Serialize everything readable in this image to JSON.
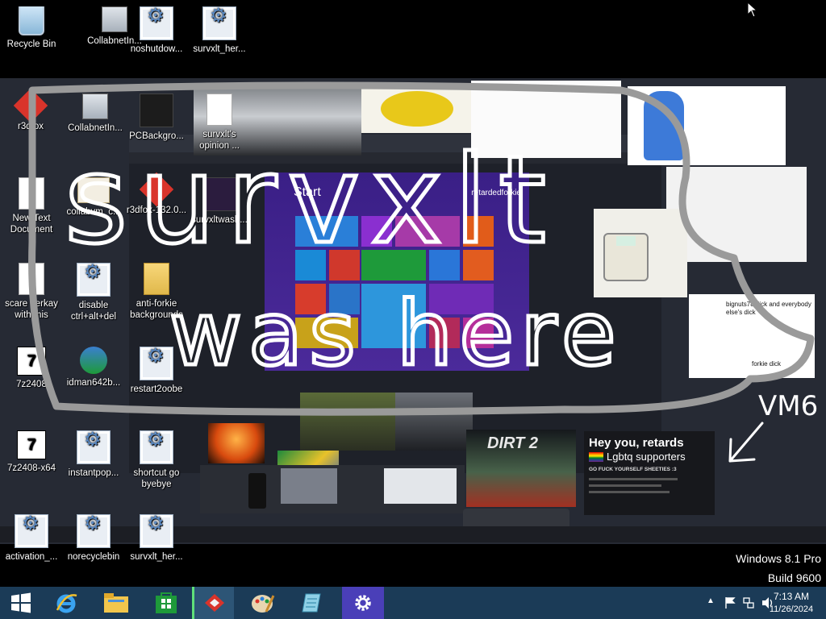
{
  "desktop": {
    "icons": [
      {
        "label": "Recycle Bin"
      },
      {
        "label": "CollabnetIn..."
      },
      {
        "label": "noshutdow..."
      },
      {
        "label": "survxlt_her..."
      },
      {
        "label": "r3dfox"
      },
      {
        "label": "CollabnetIn..."
      },
      {
        "label": "PCBackgro..."
      },
      {
        "label": "survxlt's opinion ..."
      },
      {
        "label": "New Text Document"
      },
      {
        "label": "collabvm_c..."
      },
      {
        "label": "r3dfox-132.0..."
      },
      {
        "label": "survxltwash..."
      },
      {
        "label": "scare berkay with this"
      },
      {
        "label": "disable ctrl+alt+del"
      },
      {
        "label": "anti-forkie backgrounds"
      },
      {
        "label": "7z2408"
      },
      {
        "label": "idman642b..."
      },
      {
        "label": "restart2oobe"
      },
      {
        "label": "7z2408-x64"
      },
      {
        "label": "instantpop..."
      },
      {
        "label": "shortcut go byebye"
      },
      {
        "label": "activation_..."
      },
      {
        "label": "norecyclebin"
      },
      {
        "label": "survxlt_her..."
      }
    ]
  },
  "wallpaper": {
    "start_title": "Start",
    "start_user": "retardedforkie",
    "scribble_text": [
      "survxlt",
      "was here"
    ],
    "vm_label": "VM6",
    "tweet_title": "Hey you, retards",
    "tweet_sub": "Lgbtq supporters",
    "tweet_line": "GO FUCK YOURSELF SHEETIES :3",
    "comment_text": "forkie dick",
    "comment_head": "bignuts78 dick and everybody else's dick",
    "game_title": "DIRT 2"
  },
  "watermark": {
    "line1": "Windows 8.1 Pro",
    "line2": "Build 9600"
  },
  "taskbar": {
    "clock_time": "7:13 AM",
    "clock_date": "11/26/2024"
  },
  "colors": {
    "taskbar": "#1b3b57",
    "start_bg": "#3a1f86",
    "active_indicator": "#5fe07a"
  }
}
